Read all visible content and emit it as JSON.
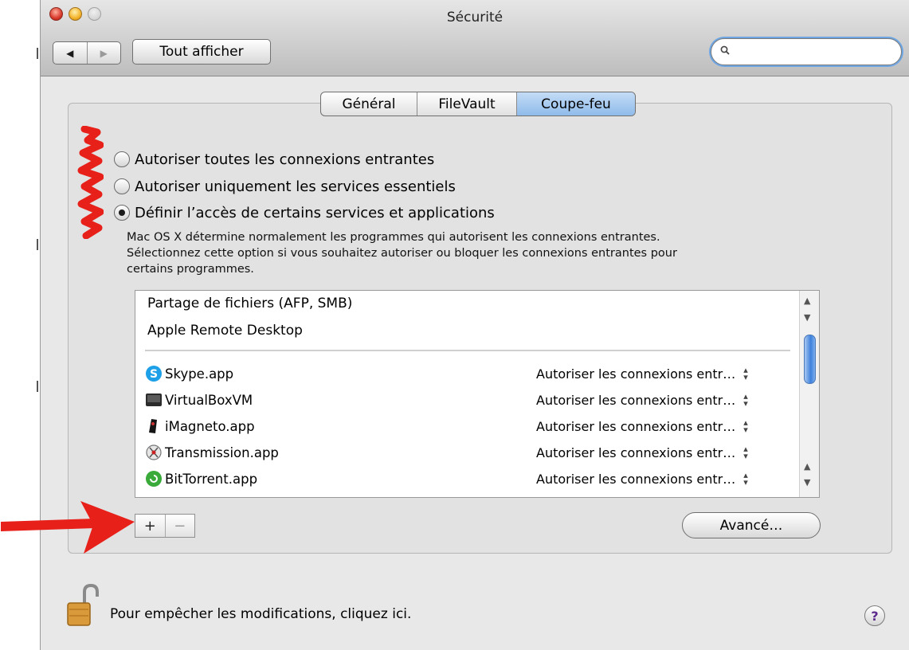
{
  "window": {
    "title": "Sécurité"
  },
  "toolbar": {
    "back_label": "◀",
    "forward_label": "▶",
    "show_all_label": "Tout afficher",
    "search_placeholder": "",
    "search_icon": "magnifier-icon"
  },
  "tabs": [
    {
      "label": "Général",
      "selected": false
    },
    {
      "label": "FileVault",
      "selected": false
    },
    {
      "label": "Coupe-feu",
      "selected": true
    }
  ],
  "firewall": {
    "options": [
      {
        "label": "Autoriser toutes les connexions entrantes",
        "selected": false
      },
      {
        "label": "Autoriser uniquement les services essentiels",
        "selected": false
      },
      {
        "label": "Définir l’accès de certains services et applications",
        "selected": true
      }
    ],
    "description_line1": "Mac OS X détermine normalement les programmes qui autorisent les connexions entrantes.",
    "description_line2": "Sélectionnez cette option si vous souhaitez autoriser ou bloquer les connexions entrantes pour",
    "description_line3": "certains programmes."
  },
  "services": [
    {
      "name": "Partage de fichiers (AFP, SMB)"
    },
    {
      "name": "Apple Remote Desktop"
    }
  ],
  "apps": [
    {
      "name": "Skype.app",
      "status": "Autoriser les connexions entr…",
      "icon": "skype-icon"
    },
    {
      "name": "VirtualBoxVM",
      "status": "Autoriser les connexions entr…",
      "icon": "virtualbox-icon"
    },
    {
      "name": "iMagneto.app",
      "status": "Autoriser les connexions entr…",
      "icon": "imagneto-icon"
    },
    {
      "name": "Transmission.app",
      "status": "Autoriser les connexions entr…",
      "icon": "transmission-icon"
    },
    {
      "name": "BitTorrent.app",
      "status": "Autoriser les connexions entr…",
      "icon": "bittorrent-icon"
    }
  ],
  "buttons": {
    "add_label": "+",
    "remove_label": "−",
    "advanced_label": "Avancé…",
    "help_label": "?"
  },
  "footer": {
    "lock_text": "Pour empêcher les modifications, cliquez ici."
  },
  "colors": {
    "selected_tab": "#8fbbea",
    "annotation": "#e8201a",
    "scroll_thumb": "#3c7fdb"
  }
}
